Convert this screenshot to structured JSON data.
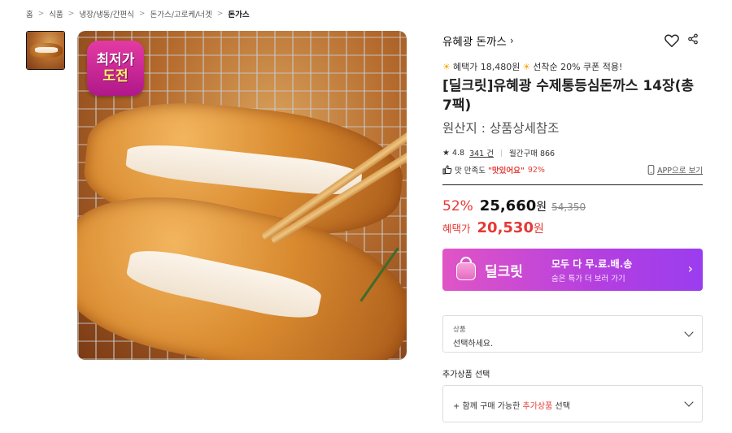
{
  "breadcrumb": [
    "홈",
    "식품",
    "냉장/냉동/간편식",
    "돈가스/고로케/너겟",
    "돈가스"
  ],
  "image": {
    "badge_line1": "최저가",
    "badge_line2": "도전"
  },
  "product": {
    "brand": "유혜광 돈까스",
    "coupon_text": "혜택가 18,480원",
    "coupon_suffix": "선착순 20% 쿠폰 적용!",
    "title": "[딜크릿]유혜광 수제통등심돈까스 14장(총 7팩)",
    "origin": "원산지 : 상품상세참조",
    "rating": "4.8",
    "review_count": "341 건",
    "monthly_purchase": "월간구매 866",
    "satisfaction_label": "맛 만족도",
    "satisfaction_quote": "\"맛있어요\"",
    "satisfaction_pct": "92%",
    "app_link": "APP으로 보기"
  },
  "price": {
    "discount": "52%",
    "sale_price": "25,660",
    "won": "원",
    "original_price": "54,350",
    "benefit_label": "혜택가",
    "benefit_price": "20,530",
    "benefit_won": "원"
  },
  "deal": {
    "name": "딜크릿",
    "main": "모두 다 무.료.배.송",
    "sub": "숨은 특가 더 보러 가기"
  },
  "options": {
    "product_label": "상품",
    "product_placeholder": "선택하세요.",
    "addon_title": "추가상품 선택",
    "addon_prefix": "+ 함께 구매 가능한",
    "addon_highlight": "추가상품",
    "addon_suffix": "선택"
  },
  "colors": {
    "accent_red": "#e53935",
    "deal_gradient_start": "#e055c6",
    "deal_gradient_end": "#9a3df0",
    "badge_pink": "#d42a9a"
  },
  "icons": [
    "heart-icon",
    "share-icon",
    "star-icon",
    "thumbs-up-icon",
    "mobile-icon",
    "chevron-right-icon",
    "chevron-down-icon",
    "sun-icon"
  ]
}
